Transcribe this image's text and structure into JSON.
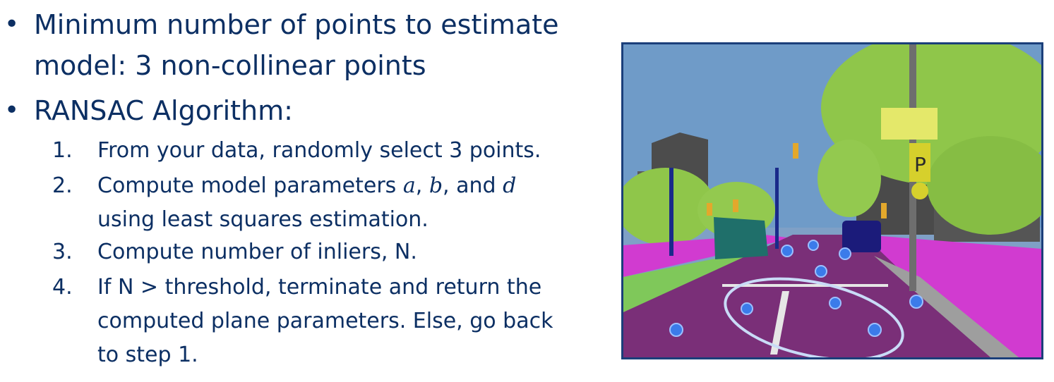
{
  "bullets": {
    "b1": {
      "line1": "Minimum number of points to estimate",
      "line2": "model: 3 non-collinear points"
    },
    "b2": {
      "text": "RANSAC Algorithm:"
    }
  },
  "steps": [
    {
      "num": "1.",
      "line1": "From your data, randomly select 3 points."
    },
    {
      "num": "2.",
      "pre": "Compute model parameters ",
      "v1": "a",
      "sep1": ", ",
      "v2": "b",
      "sep2": ", and ",
      "v3": "d",
      "line2": "using least squares estimation."
    },
    {
      "num": "3.",
      "line1": "Compute number of inliers, N."
    },
    {
      "num": "4.",
      "line1": "If N > threshold, terminate and return the",
      "line2": "computed plane parameters. Else, go back",
      "line3": "to step 1."
    }
  ],
  "figure": {
    "sign_letter": "P",
    "colors": {
      "sky": "#6f9bc8",
      "road": "#7a2f78",
      "sidewalk": "#d13bd0",
      "vegetation": "#8fc64a",
      "building": "#545454",
      "pole": "#6e6e6e",
      "point": "#3b7bea",
      "ellipse": "#c9dbf7"
    }
  }
}
